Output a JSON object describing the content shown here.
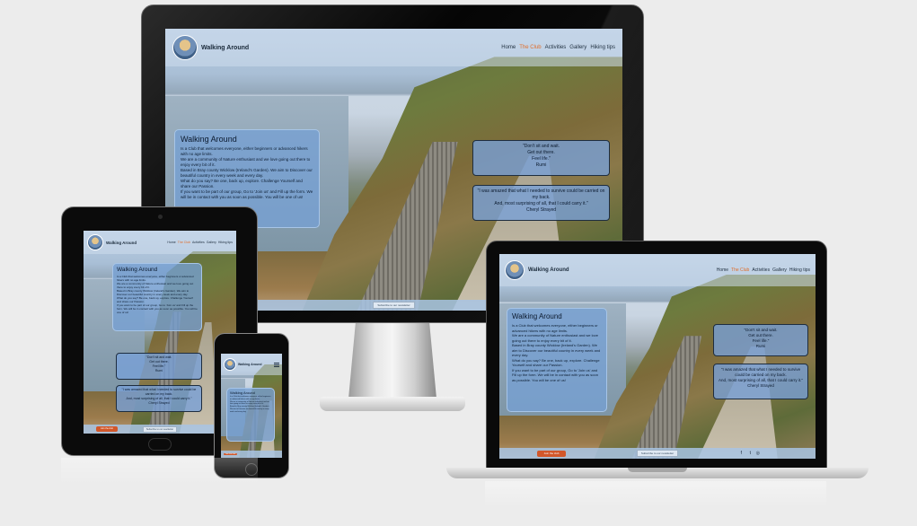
{
  "brand": "Walking Around",
  "nav": {
    "items": [
      "Home",
      "The Club",
      "Activities",
      "Gallery",
      "Hiking tips"
    ],
    "active": "The Club"
  },
  "intro": {
    "title": "Walking Around",
    "paragraphs": [
      "Is a Club that welcomes everyone, either beginners or advanced hikers with no age limits.",
      "We are a community of Nature enthusiast and we love going out there to enjoy every bit of it.",
      "Based in Bray county Wicklow (Ireland's Garden). We aim to Discover our beautiful country in every week and every day.",
      "What do you say? Be one, back up, explore. Challenge Yourself and share our Passion.",
      "If you want to be part of our group, Go to 'Join us' and Fill up the form. We will be in contact with you as soon as possible. You will be one of us!"
    ]
  },
  "quotes": [
    {
      "lines": [
        "\"Don't sit and wait.",
        "Get out there.",
        "Feel life.\"",
        "Rumi"
      ]
    },
    {
      "lines": [
        "\"I was amazed that what I needed to survive could be carried on my back.",
        "And, most surprising of all, that I could carry it.\"",
        "Cheryl Strayed"
      ]
    }
  ],
  "footer": {
    "cta": "Join the club",
    "newsletter_placeholder": "Subscribe to our newsletter",
    "social_icons": [
      "facebook-icon",
      "twitter-icon",
      "instagram-icon"
    ]
  },
  "colors": {
    "accent": "#e06d2a",
    "cta": "#d2572a",
    "box": "#76a0d4"
  }
}
